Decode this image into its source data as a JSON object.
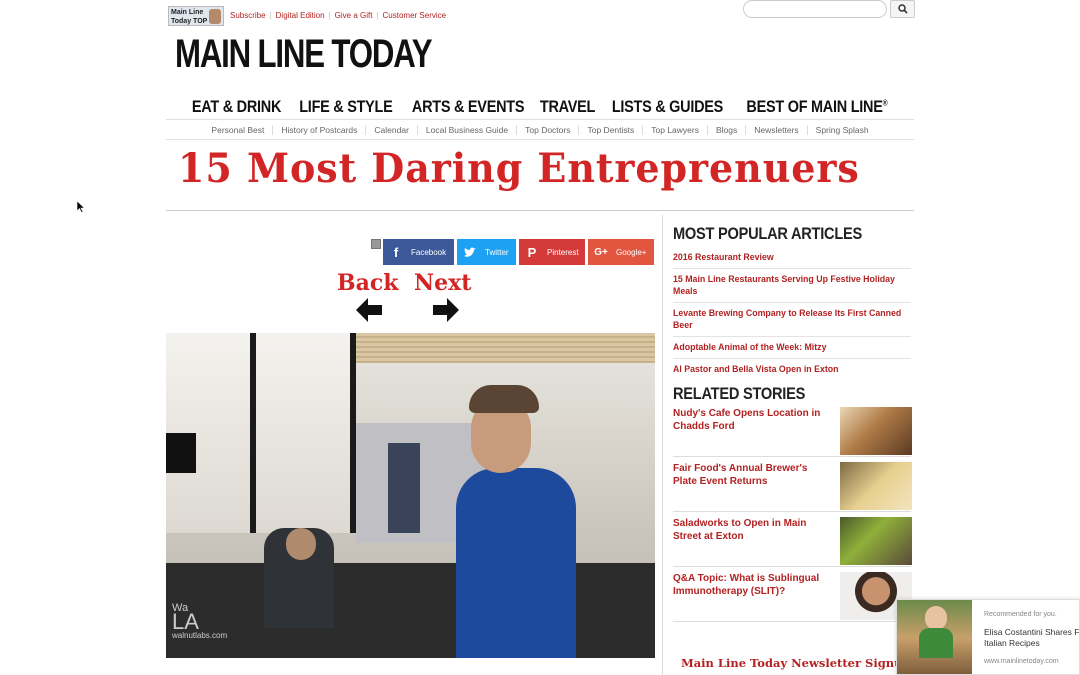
{
  "topbar": {
    "mini_logo_text": "Main Line Today TOP",
    "links": [
      "Subscribe",
      "Digital Edition",
      "Give a Gift",
      "Customer Service"
    ],
    "search_placeholder": ""
  },
  "brand": "MAIN LINE TODAY",
  "main_nav": [
    "EAT & DRINK",
    "LIFE & STYLE",
    "ARTS & EVENTS",
    "TRAVEL",
    "LISTS & GUIDES",
    "BEST OF MAIN LINE"
  ],
  "main_nav_registered": "®",
  "sub_nav": [
    "Personal Best",
    "History of Postcards",
    "Calendar",
    "Local Business Guide",
    "Top Doctors",
    "Top Dentists",
    "Top Lawyers",
    "Blogs",
    "Newsletters",
    "Spring Splash"
  ],
  "headline": "15 Most Daring Entreprenuers",
  "share": {
    "facebook": "Facebook",
    "twitter": "Twitter",
    "pinterest": "Pinterest",
    "googleplus": "Google+"
  },
  "gallery": {
    "back_label": "Back",
    "next_label": "Next",
    "watermark_top": "Wa",
    "watermark_mid": "LA",
    "watermark_bottom": "walnutlabs.com"
  },
  "sidebar": {
    "popular_title": "MOST POPULAR ARTICLES",
    "popular": [
      "2016 Restaurant Review",
      "15 Main Line Restaurants Serving Up Festive Holiday Meals",
      "Levante Brewing Company to Release Its First Canned Beer",
      "Adoptable Animal of the Week: Mitzy",
      "Al Pastor and Bella Vista Open in Exton"
    ],
    "related_title": "RELATED STORIES",
    "related": [
      "Nudy's Cafe Opens Location in Chadds Ford",
      "Fair Food's Annual Brewer's Plate Event Returns",
      "Saladworks to Open in Main Street at Exton",
      "Q&A Topic: What is Sublingual Immunotherapy (SLIT)?"
    ],
    "newsletter": "Main Line Today Newsletter Signup"
  },
  "recommendation": {
    "label": "Recommended for you.",
    "title_line1": "Elisa Costantini Shares F",
    "title_line2": "Italian Recipes",
    "source": "www.mainlinetoday.com"
  },
  "colors": {
    "accent_red": "#d22525",
    "link_red": "#b22222",
    "facebook": "#3b5998",
    "twitter": "#1da1f2",
    "pinterest": "#d53a3a",
    "googleplus": "#e2553f"
  }
}
